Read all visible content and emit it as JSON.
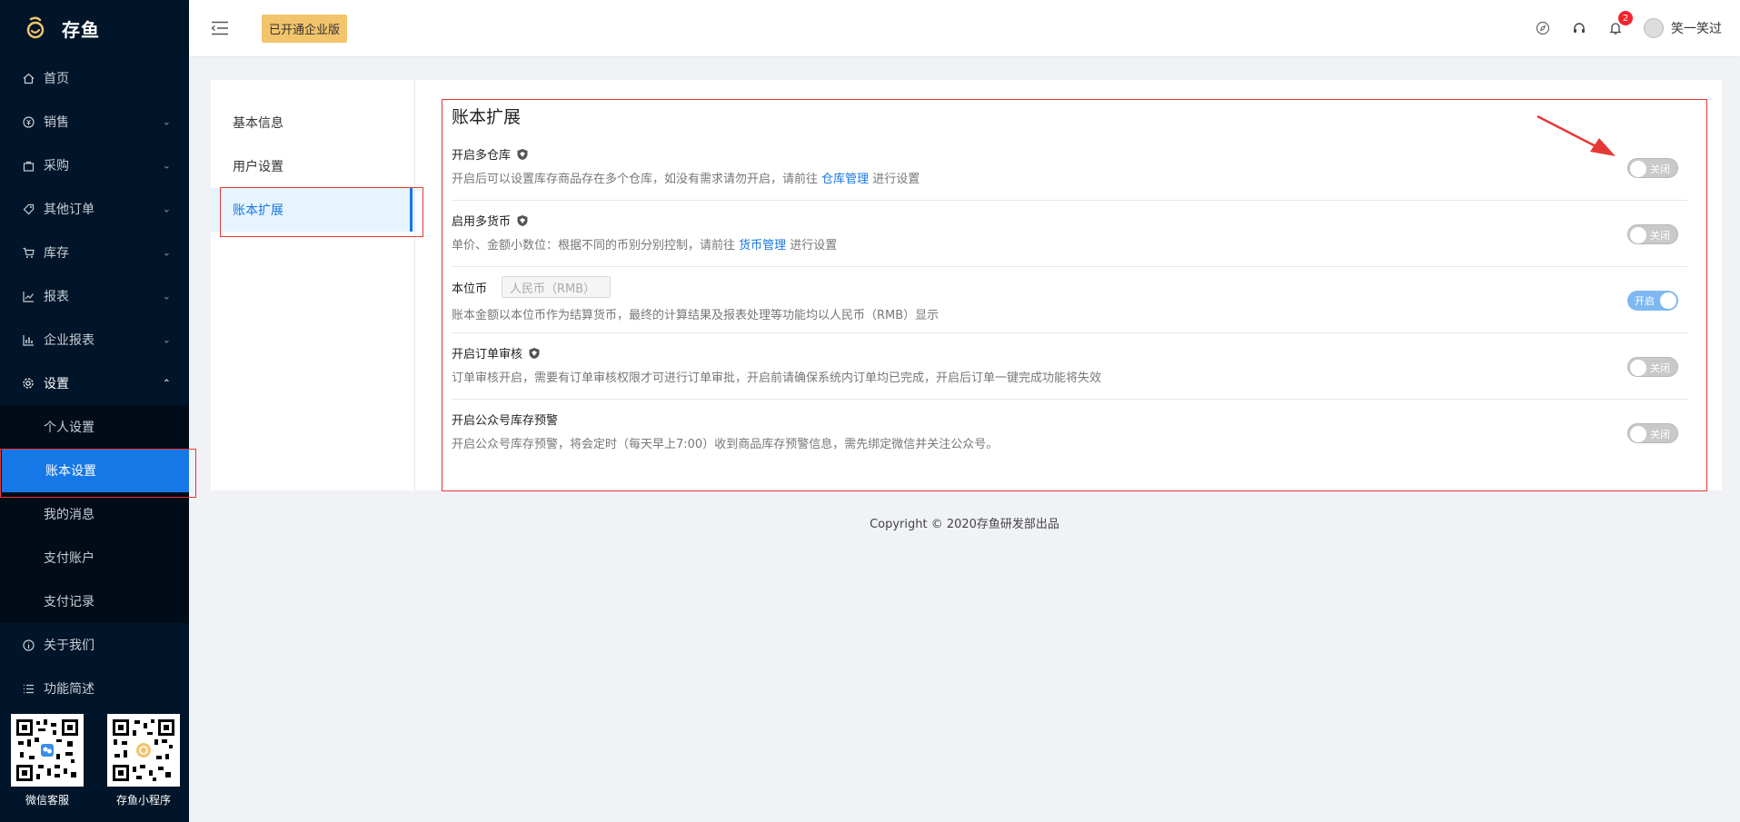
{
  "app": {
    "name": "存鱼",
    "brand_color": "#f2c46b",
    "accent_color": "#1677e6"
  },
  "sidebar": {
    "items": [
      {
        "label": "首页",
        "icon": "home-icon"
      },
      {
        "label": "销售",
        "icon": "money-icon"
      },
      {
        "label": "采购",
        "icon": "bag-icon"
      },
      {
        "label": "其他订单",
        "icon": "tag-icon"
      },
      {
        "label": "库存",
        "icon": "cart-icon"
      },
      {
        "label": "报表",
        "icon": "line-chart-icon"
      },
      {
        "label": "企业报表",
        "icon": "bar-chart-icon"
      },
      {
        "label": "设置",
        "icon": "gear-icon"
      }
    ],
    "settings_sub": [
      {
        "label": "个人设置"
      },
      {
        "label": "账本设置"
      },
      {
        "label": "我的消息"
      },
      {
        "label": "支付账户"
      },
      {
        "label": "支付记录"
      }
    ],
    "bottom_items": [
      {
        "label": "关于我们",
        "icon": "info-icon"
      },
      {
        "label": "功能简述",
        "icon": "list-icon"
      }
    ],
    "qr": [
      {
        "label": "微信客服"
      },
      {
        "label": "存鱼小程序"
      }
    ]
  },
  "header": {
    "edition_badge": "已开通企业版",
    "notification_count": "2",
    "username": "笑一笑过"
  },
  "settings_nav": [
    {
      "label": "基本信息"
    },
    {
      "label": "用户设置"
    },
    {
      "label": "账本扩展"
    }
  ],
  "panel": {
    "title": "账本扩展",
    "rows": [
      {
        "title": "开启多仓库",
        "desc_before": "开启后可以设置库存商品存在多个仓库，如没有需求请勿开启，请前往 ",
        "link": "仓库管理",
        "desc_after": " 进行设置",
        "switch_label": "关闭",
        "state": "off"
      },
      {
        "title": "启用多货币",
        "desc_before": "单价、金额小数位：根据不同的币别分别控制，请前往 ",
        "link": "货币管理",
        "desc_after": " 进行设置",
        "switch_label": "关闭",
        "state": "off"
      },
      {
        "title": "本位币",
        "input_value": "人民币（RMB）",
        "desc": "账本金额以本位币作为结算货币，最终的计算结果及报表处理等功能均以人民币（RMB）显示",
        "switch_label": "开启",
        "state": "on"
      },
      {
        "title": "开启订单审核",
        "desc": "订单审核开启，需要有订单审核权限才可进行订单审批，开启前请确保系统内订单均已完成，开启后订单一键完成功能将失效",
        "switch_label": "关闭",
        "state": "off"
      },
      {
        "title": "开启公众号库存预警",
        "desc": "开启公众号库存预警，将会定时（每天早上7:00）收到商品库存预警信息，需先绑定微信并关注公众号。",
        "switch_label": "关闭",
        "state": "off"
      }
    ]
  },
  "footer": {
    "text": "Copyright © 2020存鱼研发部出品"
  }
}
